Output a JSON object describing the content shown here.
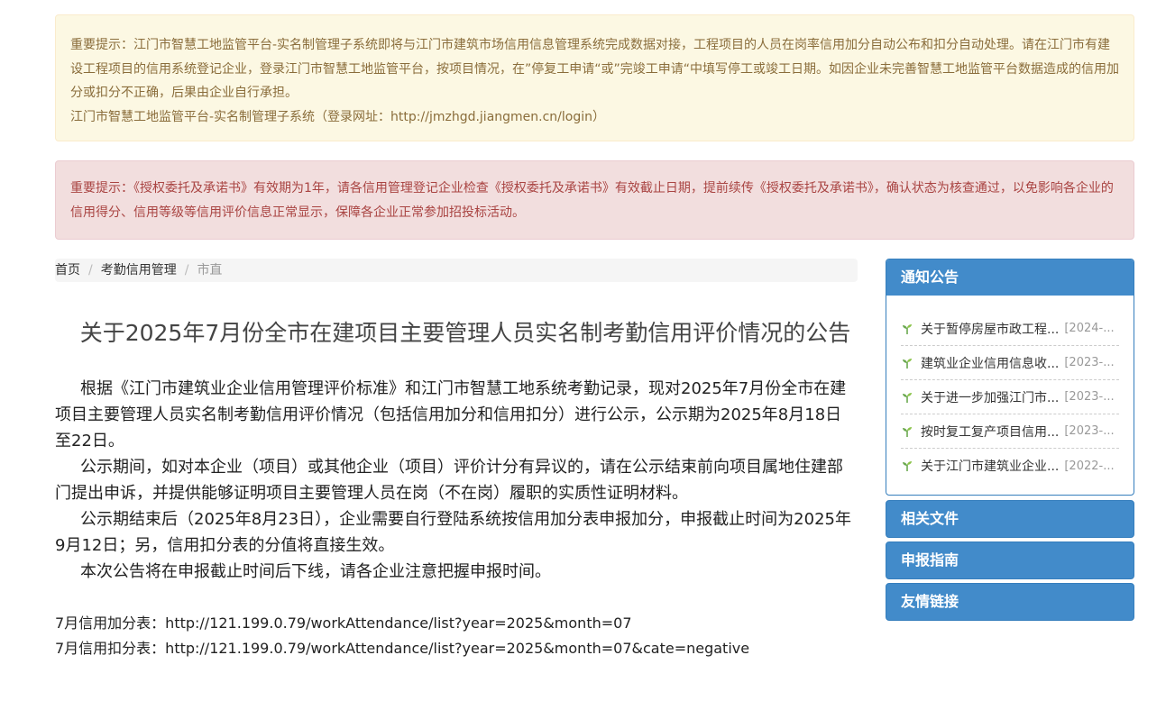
{
  "alerts": {
    "warning": {
      "text": "重要提示：江门市智慧工地监管平台-实名制管理子系统即将与江门市建筑市场信用信息管理系统完成数据对接，工程项目的人员在岗率信用加分自动公布和扣分自动处理。请在江门市有建设工程项目的信用系统登记企业，登录江门市智慧工地监管平台，按项目情况，在”停复工申请“或”完竣工申请“中填写停工或竣工日期。如因企业未完善智慧工地监管平台数据造成的信用加分或扣分不正确，后果由企业自行承担。",
      "link_line": "江门市智慧工地监管平台-实名制管理子系统（登录网址：http://jmzhgd.jiangmen.cn/login）"
    },
    "danger": {
      "text": "重要提示：《授权委托及承诺书》有效期为1年，请各信用管理登记企业检查《授权委托及承诺书》有效截止日期，提前续传《授权委托及承诺书》，确认状态为核查通过，以免影响各企业的信用得分、信用等级等信用评价信息正常显示，保障各企业正常参加招投标活动。"
    }
  },
  "breadcrumb": {
    "home": "首页",
    "section": "考勤信用管理",
    "current": "市直",
    "separator": "/"
  },
  "article": {
    "title": "关于2025年7月份全市在建项目主要管理人员实名制考勤信用评价情况的公告",
    "paragraphs": [
      "根据《江门市建筑业企业信用管理评价标准》和江门市智慧工地系统考勤记录，现对2025年7月份全市在建项目主要管理人员实名制考勤信用评价情况（包括信用加分和信用扣分）进行公示，公示期为2025年8月18日至22日。",
      "公示期间，如对本企业（项目）或其他企业（项目）评价计分有异议的，请在公示结束前向项目属地住建部门提出申诉，并提供能够证明项目主要管理人员在岗（不在岗）履职的实质性证明材料。",
      "公示期结束后（2025年8月23日），企业需要自行登陆系统按信用加分表申报加分，申报截止时间为2025年9月12日；另，信用扣分表的分值将直接生效。",
      "本次公告将在申报截止时间后下线，请各企业注意把握申报时间。"
    ],
    "links": [
      "7月信用加分表：http://121.199.0.79/workAttendance/list?year=2025&month=07",
      "7月信用扣分表：http://121.199.0.79/workAttendance/list?year=2025&month=07&cate=negative"
    ]
  },
  "sidebar": {
    "notices": {
      "heading": "通知公告",
      "items": [
        {
          "title": "关于暂停房屋市政工程...",
          "date": "[2024-..."
        },
        {
          "title": "建筑业企业信用信息收...",
          "date": "[2023-..."
        },
        {
          "title": "关于进一步加强江门市...",
          "date": "[2023-..."
        },
        {
          "title": "按时复工复产项目信用...",
          "date": "[2023-..."
        },
        {
          "title": "关于江门市建筑业企业...",
          "date": "[2022-..."
        }
      ]
    },
    "related_files": {
      "heading": "相关文件"
    },
    "guide": {
      "heading": "申报指南"
    },
    "links": {
      "heading": "友情链接"
    }
  },
  "colors": {
    "panel_blue": "#428bca",
    "sprout_green": "#6aa84f"
  }
}
